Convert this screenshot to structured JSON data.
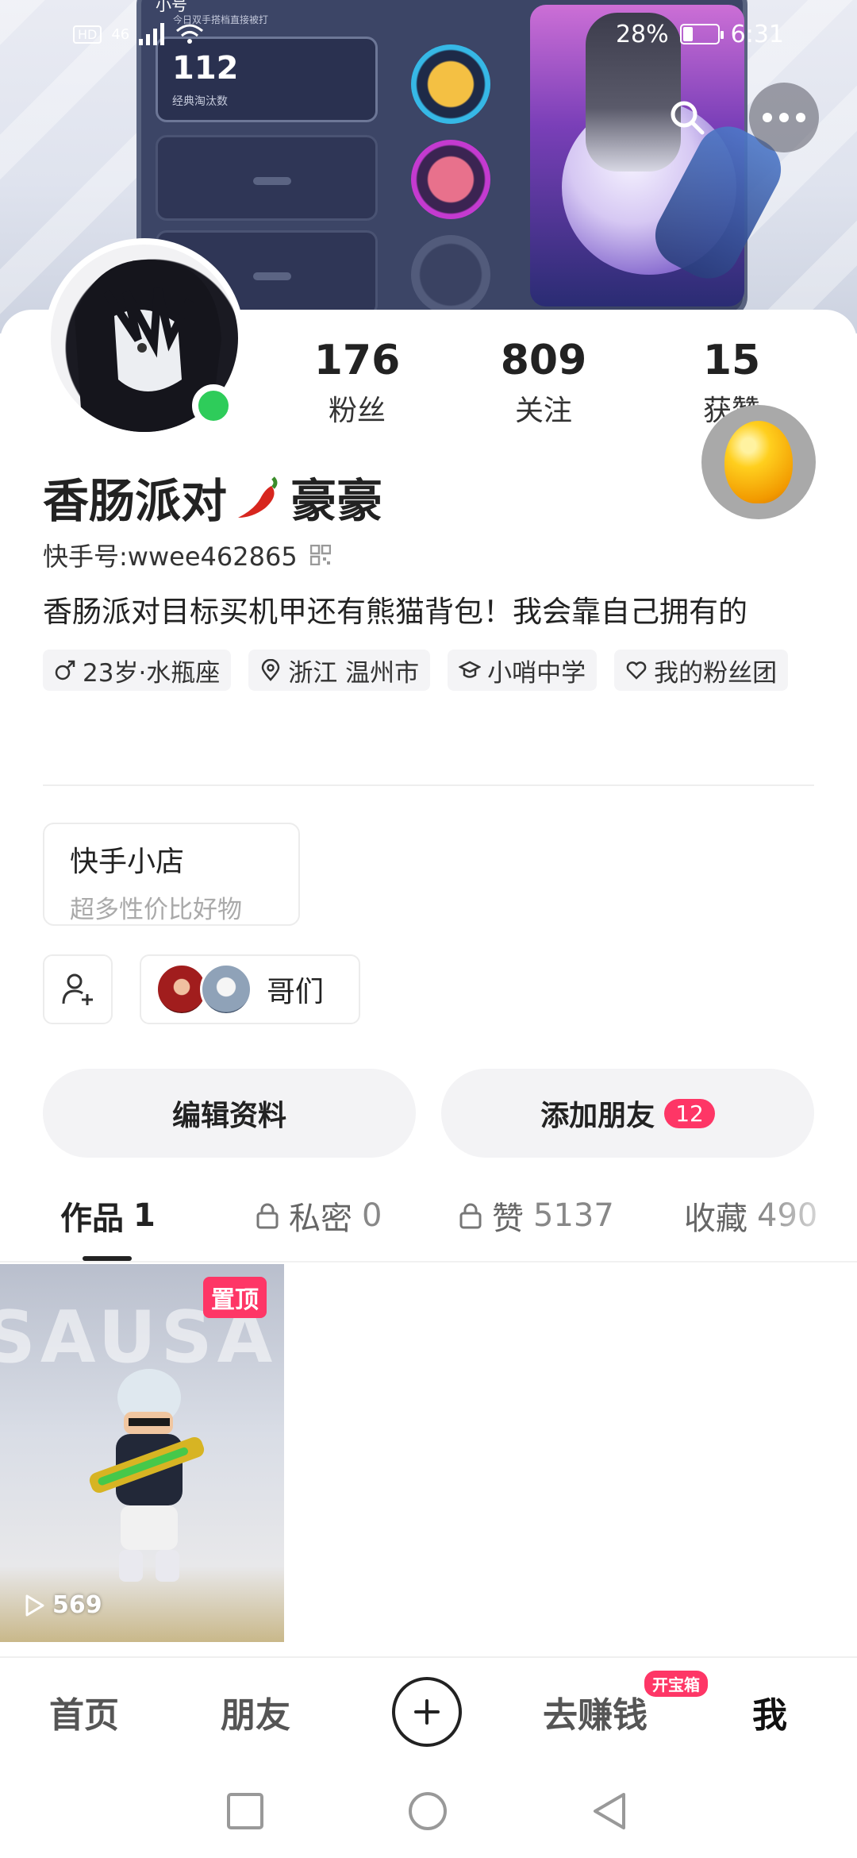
{
  "status_bar": {
    "left_badge": "HD",
    "network": "46",
    "battery": "28%",
    "battery_level": 0.28,
    "time": "6:31"
  },
  "banner": {
    "game_title": "小号",
    "game_subtitle": "今日双手搭档直接被打",
    "game_stat_number": "112",
    "game_stat_label": "经典淘汰数"
  },
  "header_actions": {
    "search_icon": "search-icon",
    "more_icon": "more-icon"
  },
  "profile": {
    "name": "香肠派对🌶️豪豪",
    "name_prefix": "香肠派对",
    "name_suffix": "豪豪",
    "kuaishou_id_label": "快手号:",
    "kuaishou_id": "wwee462865",
    "bio": "香肠派对目标买机甲还有熊猫背包！我会靠自己拥有的",
    "online": true
  },
  "stats": [
    {
      "num": "176",
      "label": "粉丝"
    },
    {
      "num": "809",
      "label": "关注"
    },
    {
      "num": "15",
      "label": "获赞"
    }
  ],
  "tags": [
    {
      "icon": "male-icon",
      "text": "23岁·水瓶座"
    },
    {
      "icon": "location-icon",
      "text": "浙江 温州市"
    },
    {
      "icon": "school-icon",
      "text": "小哨中学"
    },
    {
      "icon": "heart-icon",
      "text": "我的粉丝团"
    }
  ],
  "shop": {
    "title": "快手小店",
    "subtitle": "超多性价比好物"
  },
  "group": {
    "label": "哥们"
  },
  "actions": {
    "edit": "编辑资料",
    "add_friend": "添加朋友",
    "add_friend_badge": "12"
  },
  "tabs": [
    {
      "label": "作品",
      "count": "1",
      "locked": false,
      "active": true
    },
    {
      "label": "私密",
      "count": "0",
      "locked": true,
      "active": false
    },
    {
      "label": "赞",
      "count": "5137",
      "locked": true,
      "active": false
    },
    {
      "label": "收藏",
      "count": "490",
      "locked": false,
      "active": false
    }
  ],
  "works": [
    {
      "pinned_label": "置顶",
      "views": "569",
      "watermark": "SAUSA"
    }
  ],
  "bottom_nav": {
    "home": "首页",
    "friends": "朋友",
    "earn": "去赚钱",
    "earn_badge": "开宝箱",
    "me": "我"
  },
  "colors": {
    "accent": "#fe3666",
    "online": "#2ecc5a"
  }
}
